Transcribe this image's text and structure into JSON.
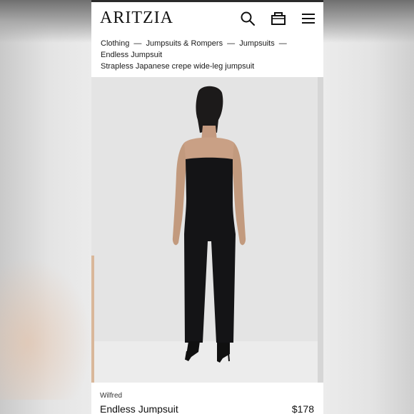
{
  "header": {
    "logo": "ARITZIA",
    "icons": [
      "search-icon",
      "bag-icon",
      "menu-icon"
    ]
  },
  "breadcrumb": {
    "items": [
      "Clothing",
      "Jumpsuits & Rompers",
      "Jumpsuits",
      "Endless Jumpsuit"
    ],
    "separator": "—"
  },
  "product": {
    "subtitle": "Strapless Japanese crepe wide-leg jumpsuit",
    "brand": "Wilfred",
    "name": "Endless Jumpsuit",
    "price": "$178"
  },
  "colors": {
    "text": "#111111",
    "garment": "#141416",
    "background": "#e4e4e4"
  }
}
